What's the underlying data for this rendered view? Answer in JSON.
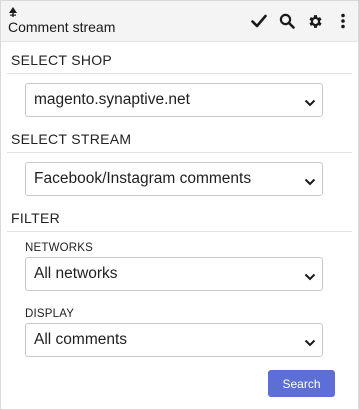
{
  "header": {
    "title": "Comment stream",
    "icons": [
      "pin-icon",
      "check-icon",
      "search-icon",
      "gear-icon",
      "more-vertical-icon"
    ]
  },
  "shop": {
    "section_title": "SELECT SHOP",
    "selected": "magento.synaptive.net"
  },
  "stream": {
    "section_title": "SELECT STREAM",
    "selected": "Facebook/Instagram comments"
  },
  "filter": {
    "section_title": "FILTER",
    "networks_label": "NETWORKS",
    "networks_selected": "All networks",
    "display_label": "DISPLAY",
    "display_selected": "All comments"
  },
  "actions": {
    "search_label": "Search"
  },
  "colors": {
    "accent": "#5d6fd6",
    "header_bg": "#f4f4f4"
  }
}
